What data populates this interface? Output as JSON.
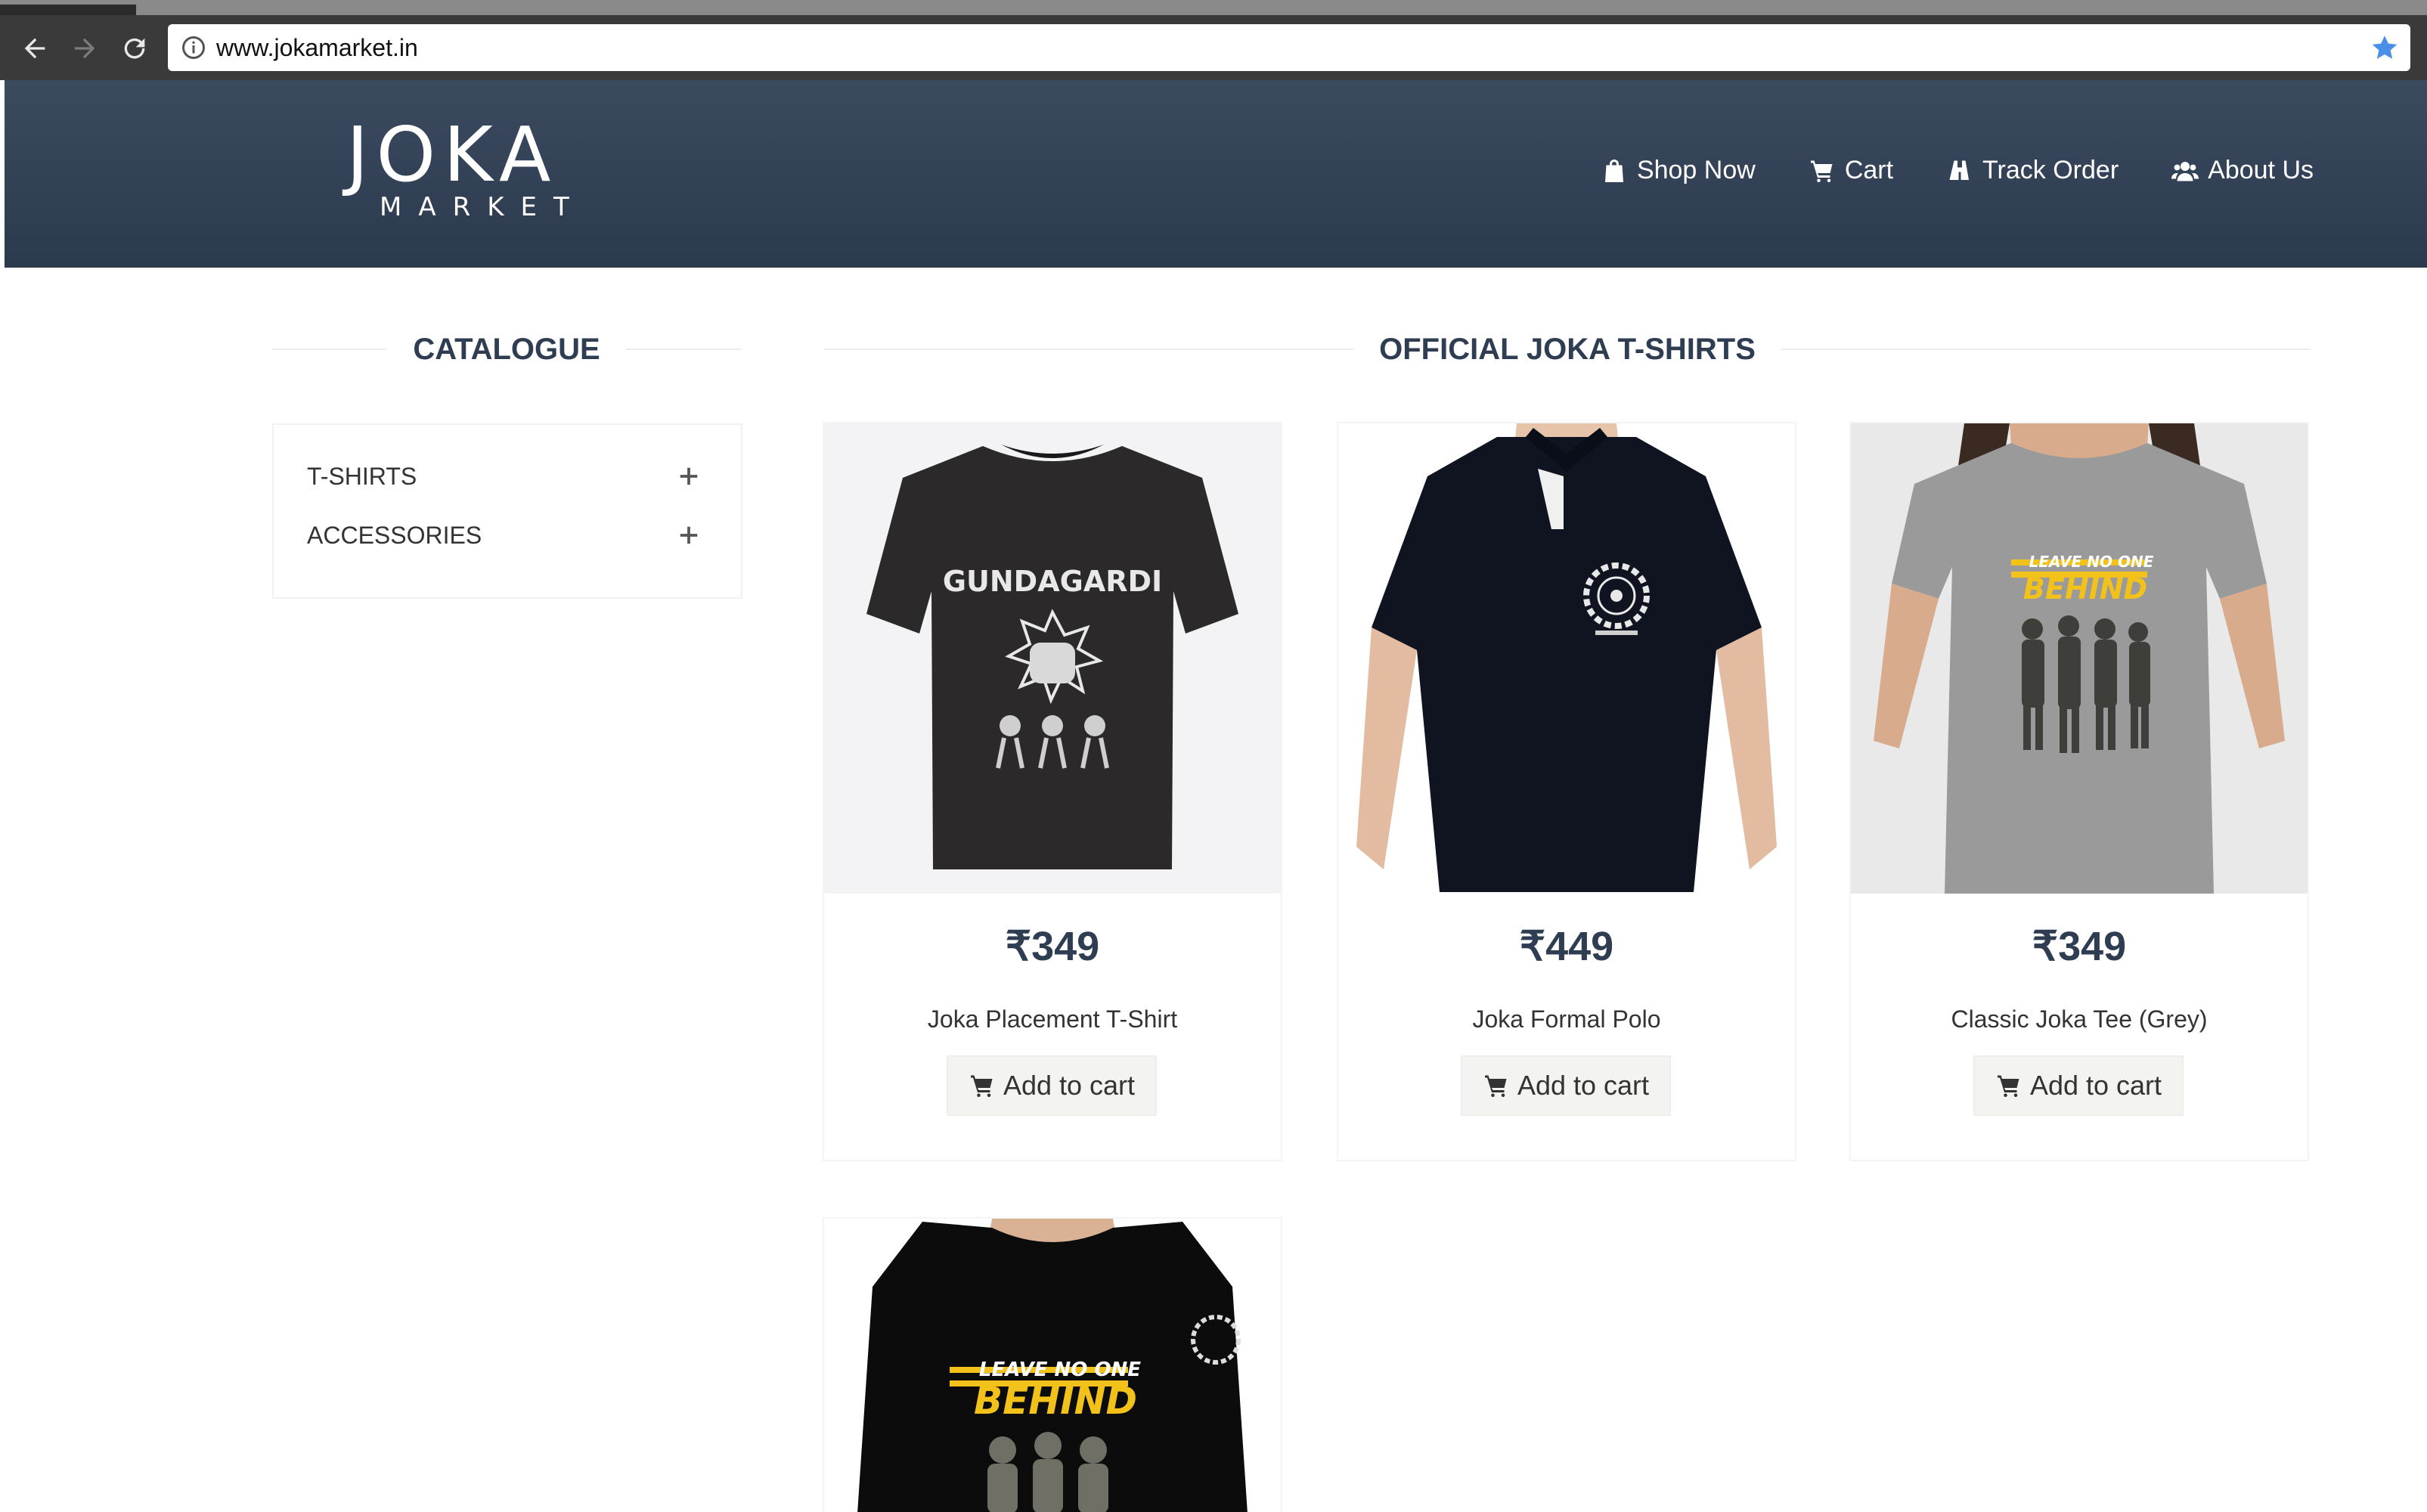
{
  "browser": {
    "url": "www.jokamarket.in"
  },
  "header": {
    "logo_main": "JOKA",
    "logo_sub": "MARKET",
    "nav": [
      {
        "label": "Shop Now",
        "icon": "shopping-bag-icon"
      },
      {
        "label": "Cart",
        "icon": "cart-icon"
      },
      {
        "label": "Track Order",
        "icon": "binoculars-icon"
      },
      {
        "label": "About Us",
        "icon": "users-icon"
      }
    ],
    "bg_color": "#344257"
  },
  "sidebar": {
    "title": "CATALOGUE",
    "items": [
      {
        "label": "T-SHIRTS",
        "icon": "plus-icon"
      },
      {
        "label": "ACCESSORIES",
        "icon": "plus-icon"
      }
    ]
  },
  "products": {
    "title": "OFFICIAL JOKA T-SHIRTS",
    "add_to_cart_label": "Add to cart",
    "items": [
      {
        "price": "₹349",
        "name": "Joka Placement T-Shirt",
        "print_text": "GUNDAGARDI"
      },
      {
        "price": "₹449",
        "name": "Joka Formal Polo"
      },
      {
        "price": "₹349",
        "name": "Classic Joka Tee (Grey)",
        "print_text_top": "LEAVE NO ONE",
        "print_text_main": "BEHIND"
      },
      {
        "print_text_top": "LEAVE NO ONE",
        "print_text_main": "BEHIND"
      }
    ]
  },
  "colors": {
    "heading": "#2e3d52",
    "accent_yellow": "#f2c21b"
  }
}
